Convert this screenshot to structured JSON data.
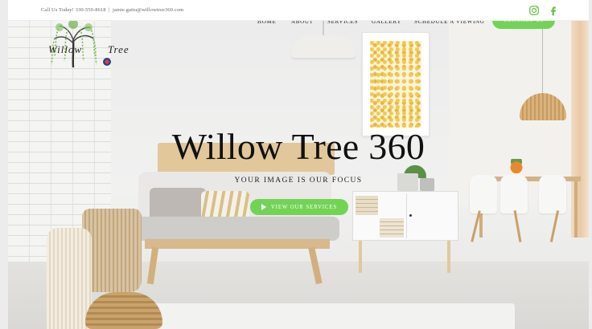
{
  "topbar": {
    "contact_text": "Call Us Today! 330-550-8618  |  jamie.gaitu@willowtree360.com",
    "social": [
      "instagram-icon",
      "facebook-icon"
    ]
  },
  "logo": {
    "word_left": "Willow",
    "word_right": "Tree"
  },
  "nav": {
    "items": [
      "HOME",
      "ABOUT",
      "SERVICES",
      "GALLERY",
      "SCHEDULE A VIEWING"
    ],
    "cta": "CONTACT US"
  },
  "hero": {
    "title": "Willow Tree 360",
    "tagline": "YOUR IMAGE IS OUR FOCUS",
    "button": "VIEW OUR SERVICES"
  },
  "colors": {
    "accent": "#72d357",
    "social": "#6cc24a",
    "text": "#111111"
  }
}
